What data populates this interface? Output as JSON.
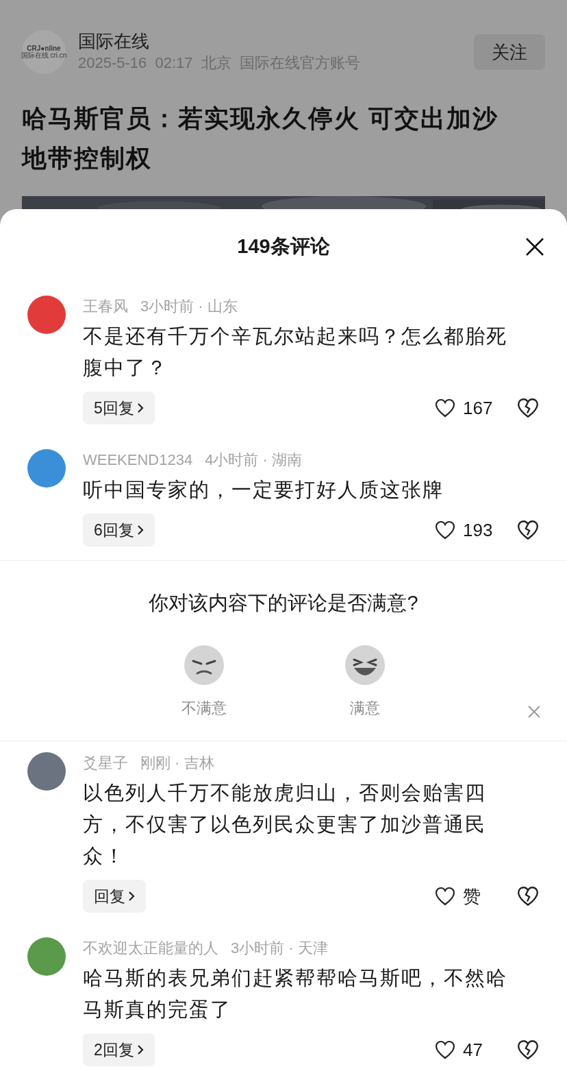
{
  "article": {
    "source": "国际在线",
    "logo_line_1": "CRJ●nline",
    "logo_line_2": "国际在线 cri.cn",
    "meta": "2025-5-16  02:17  北京  国际在线官方账号",
    "follow_button": "关注",
    "title": "哈马斯官员：若实现永久停火 可交出加沙地带控制权"
  },
  "comments_sheet": {
    "title": "149条评论",
    "comments": [
      {
        "user": "王春风",
        "time_location": "3小时前 · 山东",
        "text": "不是还有千万个辛瓦尔站起来吗？怎么都胎死腹中了？",
        "replies": "5回复",
        "likes": "167",
        "color": "#e23b3b"
      },
      {
        "user": "WEEKEND1234",
        "time_location": "4小时前 · 湖南",
        "text": "听中国专家的，一定要打好人质这张牌",
        "replies": "6回复",
        "likes": "193",
        "color": "#3a8fd8"
      }
    ],
    "survey": {
      "question": "你对该内容下的评论是否满意?",
      "options": [
        {
          "kind": "unhappy",
          "label": "不满意"
        },
        {
          "kind": "happy",
          "label": "满意"
        }
      ]
    },
    "more_comments": [
      {
        "user": "爻星子",
        "time_location": "刚刚 · 吉林",
        "text": "以色列人千万不能放虎归山，否则会贻害四方，不仅害了以色列民众更害了加沙普通民众！",
        "replies": "回复",
        "likes": "赞",
        "color": "#6b7280"
      },
      {
        "user": "不欢迎太正能量的人",
        "time_location": "3小时前 · 天津",
        "text": "哈马斯的表兄弟们赶紧帮帮哈马斯吧，不然哈马斯真的完蛋了",
        "replies": "2回复",
        "likes": "47",
        "color": "#5a9a4a"
      }
    ]
  }
}
